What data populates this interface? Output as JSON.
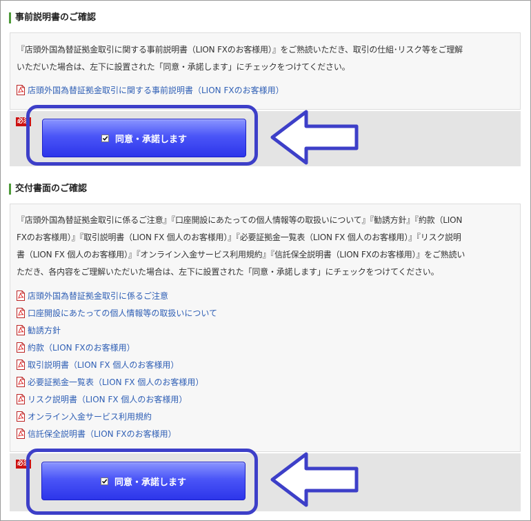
{
  "section1": {
    "heading": "事前説明書のご確認",
    "body_lines": [
      "『店頭外国為替証拠金取引に関する事前説明書（LION FXのお客様用）』をご熟読いただき、取引の仕組･リスク等をご理解",
      "いただいた場合は、左下に設置された「同意・承諾します」にチェックをつけてください。"
    ],
    "links": [
      {
        "label": "店頭外国為替証拠金取引に関する事前説明書（LION FXのお客様用）",
        "icon": "pdf-icon"
      }
    ],
    "required_badge": "必須",
    "agree_label": "同意・承諾します",
    "agree_checked": true
  },
  "section2": {
    "heading": "交付書面のご確認",
    "body_lines": [
      "『店頭外国為替証拠金取引に係るご注意』『口座開設にあたっての個人情報等の取扱いについて』『勧誘方針』『約款（LION",
      "FXのお客様用）』『取引説明書（LION FX 個人のお客様用）』『必要証拠金一覧表（LION FX 個人のお客様用）』『リスク説明",
      "書（LION FX 個人のお客様用）』『オンライン入金サービス利用規約』『信託保全説明書（LION FXのお客様用）』をご熟読い",
      "ただき、各内容をご理解いただいた場合は、左下に設置された「同意・承諾します」にチェックをつけてください。"
    ],
    "links": [
      {
        "label": "店頭外国為替証拠金取引に係るご注意",
        "icon": "pdf-icon"
      },
      {
        "label": "口座開設にあたっての個人情報等の取扱いについて",
        "icon": "pdf-icon"
      },
      {
        "label": "勧誘方針",
        "icon": "pdf-icon"
      },
      {
        "label": "約款（LION FXのお客様用）",
        "icon": "pdf-icon"
      },
      {
        "label": "取引説明書（LION FX 個人のお客様用）",
        "icon": "pdf-icon"
      },
      {
        "label": "必要証拠金一覧表（LION FX 個人のお客様用）",
        "icon": "pdf-icon"
      },
      {
        "label": "リスク説明書（LION FX 個人のお客様用）",
        "icon": "pdf-icon"
      },
      {
        "label": "オンライン入金サービス利用規約",
        "icon": "pdf-icon"
      },
      {
        "label": "信託保全説明書（LION FXのお客様用）",
        "icon": "pdf-icon"
      }
    ],
    "required_badge": "必須",
    "agree_label": "同意・承諾します",
    "agree_checked": true
  },
  "colors": {
    "link": "#2f5fb5",
    "button": "#3a44f0",
    "annotation": "#3d3fc8",
    "heading_bar": "#4e9a39",
    "required": "#cc1111"
  }
}
